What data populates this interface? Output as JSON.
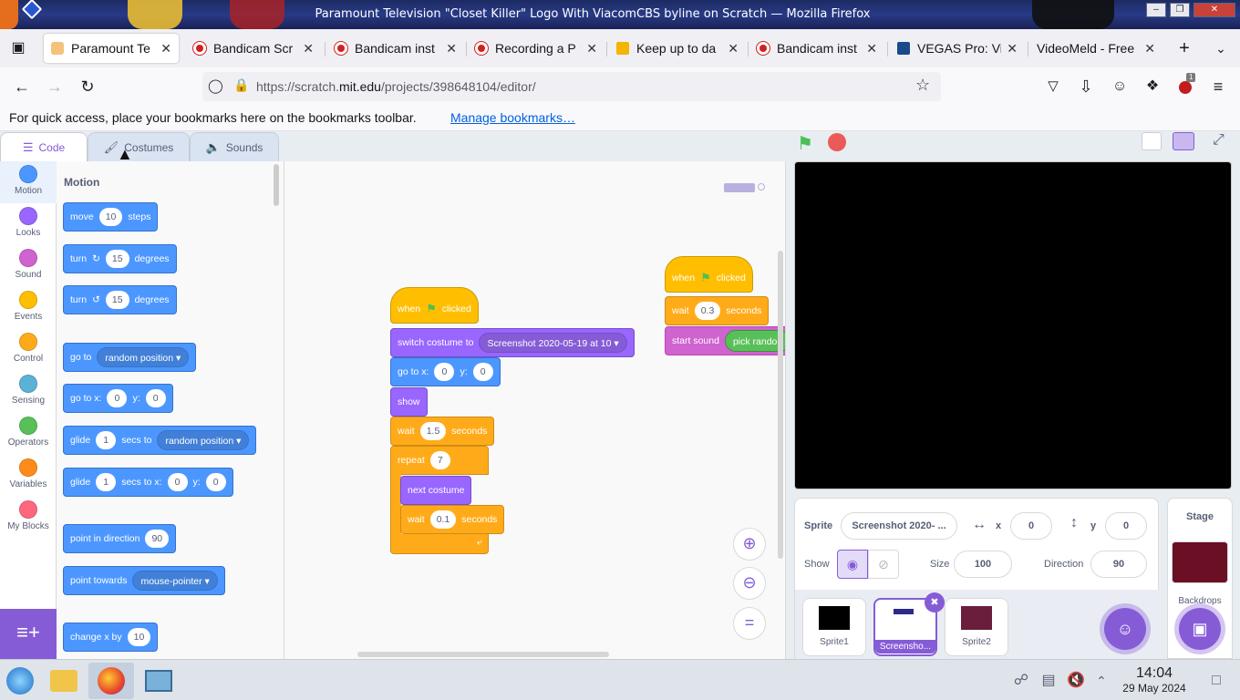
{
  "window": {
    "title": "Paramount Television \"Closet Killer\" Logo With ViacomCBS byline on Scratch — Mozilla Firefox"
  },
  "browser": {
    "tabs": [
      {
        "label": "Paramount Te",
        "active": true
      },
      {
        "label": "Bandicam Scr"
      },
      {
        "label": "Bandicam inst"
      },
      {
        "label": "Recording a P"
      },
      {
        "label": "Keep up to da"
      },
      {
        "label": "Bandicam inst"
      },
      {
        "label": "VEGAS Pro: Vi"
      },
      {
        "label": "VideoMeld - Free"
      }
    ],
    "url_prefix": "https://scratch.",
    "url_domain": "mit.edu",
    "url_path": "/projects/398648104/editor/",
    "bookmarks_msg": "For quick access, place your bookmarks here on the bookmarks toolbar.",
    "bookmarks_link": "Manage bookmarks…",
    "extension_badge": "1"
  },
  "editor": {
    "tabs": {
      "code": "Code",
      "costumes": "Costumes",
      "sounds": "Sounds"
    },
    "categories": [
      {
        "label": "Motion",
        "color": "#4c97ff"
      },
      {
        "label": "Looks",
        "color": "#9966ff"
      },
      {
        "label": "Sound",
        "color": "#cf63cf"
      },
      {
        "label": "Events",
        "color": "#ffbf00"
      },
      {
        "label": "Control",
        "color": "#ffab19"
      },
      {
        "label": "Sensing",
        "color": "#5cb1d6"
      },
      {
        "label": "Operators",
        "color": "#59c059"
      },
      {
        "label": "Variables",
        "color": "#ff8c1a"
      },
      {
        "label": "My Blocks",
        "color": "#ff6680"
      }
    ],
    "palette": {
      "heading": "Motion",
      "move": {
        "pre": "move",
        "val": "10",
        "post": "steps"
      },
      "turn_right": {
        "pre": "turn",
        "val": "15",
        "post": "degrees"
      },
      "turn_left": {
        "pre": "turn",
        "val": "15",
        "post": "degrees"
      },
      "goto": {
        "pre": "go to",
        "dd": "random position"
      },
      "gotoxy": {
        "pre": "go to x:",
        "x": "0",
        "ylbl": "y:",
        "y": "0"
      },
      "glide": {
        "pre": "glide",
        "val": "1",
        "mid": "secs to",
        "dd": "random position"
      },
      "glidexy": {
        "pre": "glide",
        "val": "1",
        "mid": "secs to x:",
        "x": "0",
        "ylbl": "y:",
        "y": "0"
      },
      "point_dir": {
        "pre": "point in direction",
        "val": "90"
      },
      "point_towards": {
        "pre": "point towards",
        "dd": "mouse-pointer"
      },
      "change_x": {
        "pre": "change x by",
        "val": "10"
      }
    },
    "script1": {
      "hat": {
        "pre": "when",
        "post": "clicked"
      },
      "switch": {
        "pre": "switch costume to",
        "dd": "Screenshot 2020-05-19 at 10"
      },
      "goto": {
        "pre": "go to x:",
        "x": "0",
        "ylbl": "y:",
        "y": "0"
      },
      "show": "show",
      "wait1": {
        "pre": "wait",
        "val": "1.5",
        "post": "seconds"
      },
      "repeat": {
        "pre": "repeat",
        "val": "7"
      },
      "next": "next costume",
      "wait2": {
        "pre": "wait",
        "val": "0.1",
        "post": "seconds"
      }
    },
    "script2": {
      "hat": {
        "pre": "when",
        "post": "clicked"
      },
      "wait": {
        "pre": "wait",
        "val": "0.3",
        "post": "seconds"
      },
      "sound": {
        "pre": "start sound",
        "op": "pick randon"
      }
    }
  },
  "sprite_info": {
    "label": "Sprite",
    "name": "Screenshot 2020- ...",
    "x_label": "x",
    "x": "0",
    "y_label": "y",
    "y": "0",
    "show_label": "Show",
    "size_label": "Size",
    "size": "100",
    "direction_label": "Direction",
    "direction": "90"
  },
  "sprites": [
    {
      "name": "Sprite1"
    },
    {
      "name": "Screensho...",
      "selected": true
    },
    {
      "name": "Sprite2"
    }
  ],
  "stage_panel": {
    "title": "Stage",
    "backdrops_label": "Backdrops"
  },
  "taskbar": {
    "time": "14:04",
    "date": "29 May 2024"
  }
}
